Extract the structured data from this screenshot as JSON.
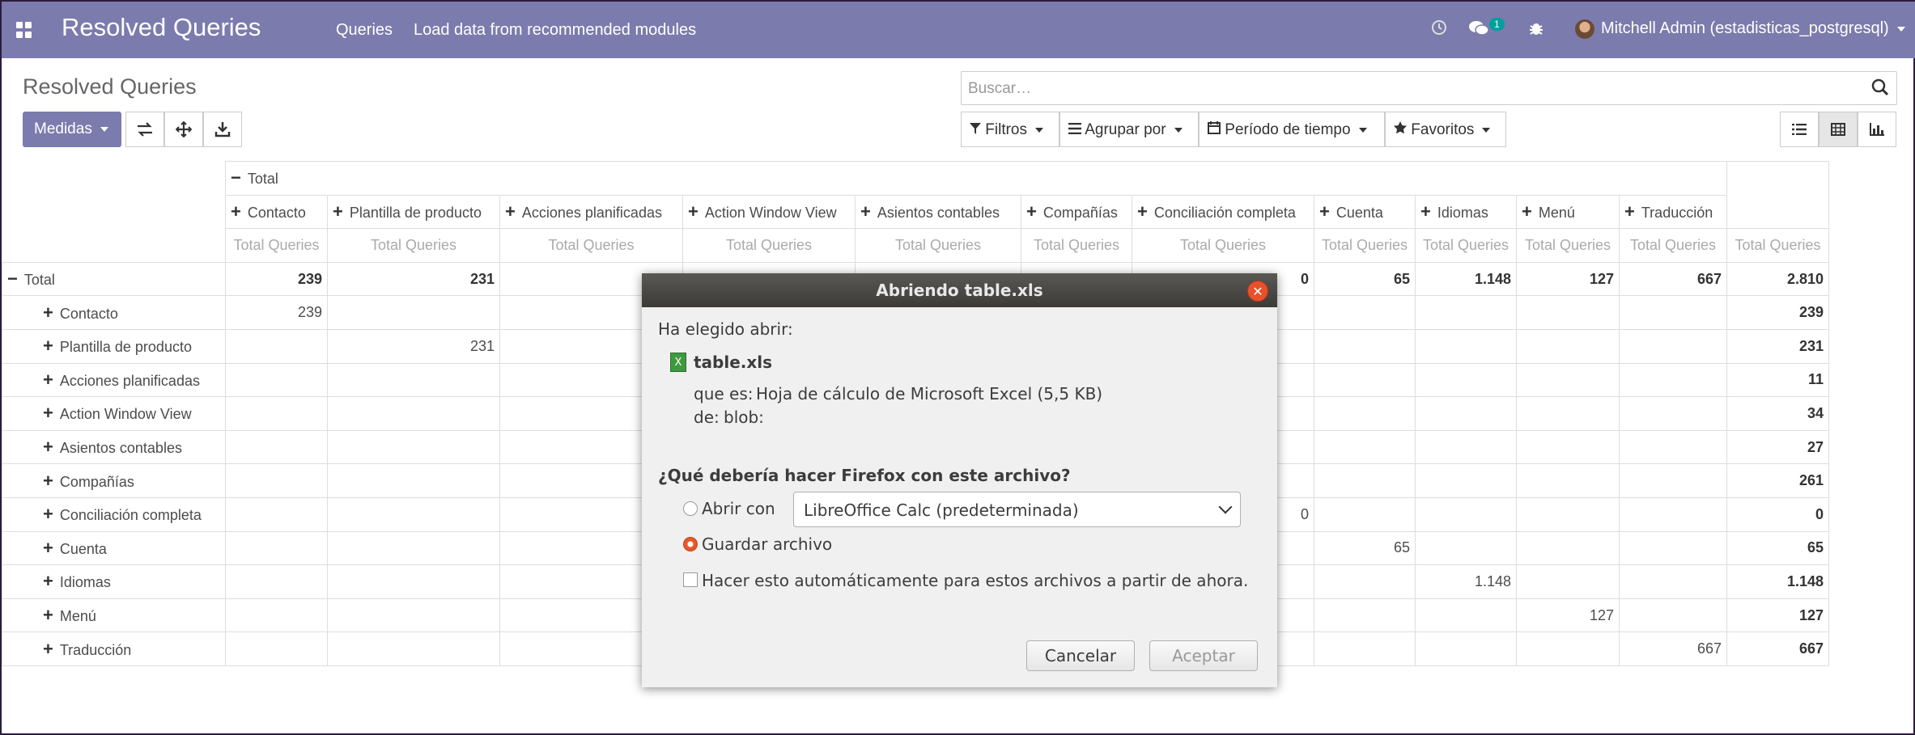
{
  "topbar": {
    "app_title": "Resolved Queries",
    "menu": [
      "Queries",
      "Load data from recommended modules"
    ],
    "chat_badge": "1",
    "user": "Mitchell Admin (estadisticas_postgresql)"
  },
  "control_panel": {
    "page_title": "Resolved Queries",
    "search_placeholder": "Buscar…",
    "measures_label": "Medidas",
    "filters_label": "Filtros",
    "groupby_label": "Agrupar por",
    "period_label": "Período de tiempo",
    "favorites_label": "Favoritos"
  },
  "pivot": {
    "total_label": "Total",
    "measure": "Total Queries",
    "columns": [
      "Contacto",
      "Plantilla de producto",
      "Acciones planificadas",
      "Action Window View",
      "Asientos contables",
      "Compañías",
      "Conciliación completa",
      "Cuenta",
      "Idiomas",
      "Menú",
      "Traducción"
    ],
    "total_row_visible": [
      "239",
      "231",
      "",
      "",
      "",
      "",
      "0",
      "65",
      "1.148",
      "127",
      "667",
      "2.810"
    ],
    "rows": [
      {
        "label": "Contacto",
        "cells": [
          "239",
          "",
          "",
          "",
          "",
          "",
          "",
          "",
          "",
          "",
          ""
        ],
        "total": "239"
      },
      {
        "label": "Plantilla de producto",
        "cells": [
          "",
          "231",
          "",
          "",
          "",
          "",
          "",
          "",
          "",
          "",
          ""
        ],
        "total": "231"
      },
      {
        "label": "Acciones planificadas",
        "cells": [
          "",
          "",
          "",
          "",
          "",
          "",
          "",
          "",
          "",
          "",
          ""
        ],
        "total": "11"
      },
      {
        "label": "Action Window View",
        "cells": [
          "",
          "",
          "",
          "",
          "",
          "",
          "",
          "",
          "",
          "",
          ""
        ],
        "total": "34"
      },
      {
        "label": "Asientos contables",
        "cells": [
          "",
          "",
          "",
          "",
          "",
          "",
          "",
          "",
          "",
          "",
          ""
        ],
        "total": "27"
      },
      {
        "label": "Compañías",
        "cells": [
          "",
          "",
          "",
          "",
          "",
          "",
          "",
          "",
          "",
          "",
          ""
        ],
        "total": "261"
      },
      {
        "label": "Conciliación completa",
        "cells": [
          "",
          "",
          "",
          "",
          "",
          "",
          "0",
          "",
          "",
          "",
          ""
        ],
        "total": "0"
      },
      {
        "label": "Cuenta",
        "cells": [
          "",
          "",
          "",
          "",
          "",
          "",
          "",
          "65",
          "",
          "",
          ""
        ],
        "total": "65"
      },
      {
        "label": "Idiomas",
        "cells": [
          "",
          "",
          "",
          "",
          "",
          "",
          "",
          "",
          "1.148",
          "",
          ""
        ],
        "total": "1.148"
      },
      {
        "label": "Menú",
        "cells": [
          "",
          "",
          "",
          "",
          "",
          "",
          "",
          "",
          "",
          "127",
          ""
        ],
        "total": "127"
      },
      {
        "label": "Traducción",
        "cells": [
          "",
          "",
          "",
          "",
          "",
          "",
          "",
          "",
          "",
          "",
          "667"
        ],
        "total": "667"
      }
    ]
  },
  "dialog": {
    "title": "Abriendo table.xls",
    "intro": "Ha elegido abrir:",
    "filename": "table.xls",
    "type_label": "que es:",
    "type_value": "Hoja de cálculo de Microsoft Excel (5,5 KB)",
    "from_label": "de:",
    "from_value": "blob:",
    "question": "¿Qué debería hacer Firefox con este archivo?",
    "open_with_label": "Abrir con",
    "open_with_value": "LibreOffice Calc (predeterminada)",
    "save_label": "Guardar archivo",
    "auto_label": "Hacer esto automáticamente para estos archivos a partir de ahora.",
    "cancel_label": "Cancelar",
    "accept_label": "Aceptar"
  }
}
